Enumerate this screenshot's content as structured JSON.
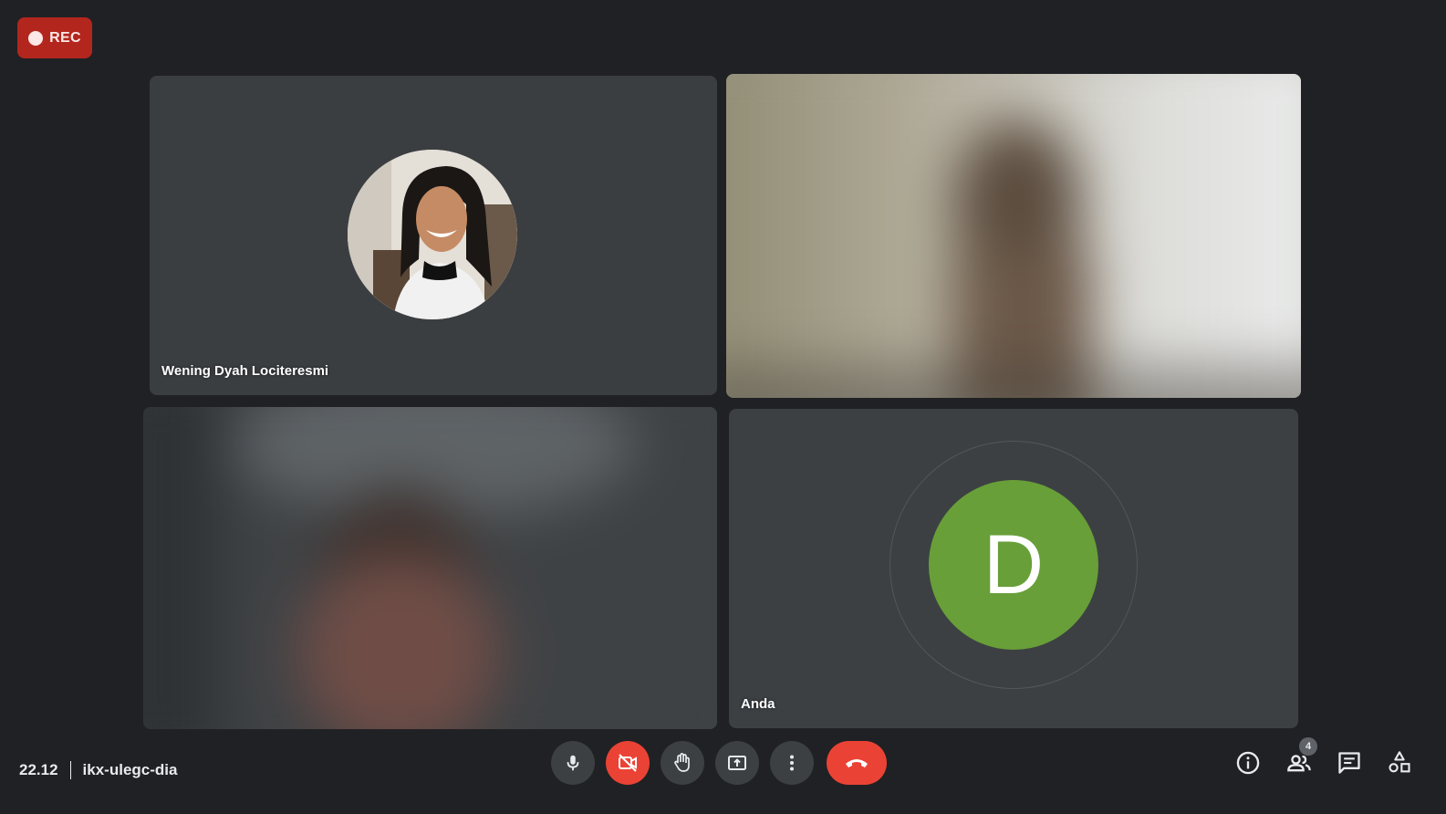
{
  "recording": {
    "label": "REC"
  },
  "participants": [
    {
      "name": "Wening Dyah Lociteresmi",
      "avatar_type": "photo"
    },
    {
      "name": "",
      "avatar_type": "video"
    },
    {
      "name": "",
      "avatar_type": "video"
    },
    {
      "name": "Anda",
      "avatar_type": "letter",
      "initial": "D",
      "avatar_color": "#689f38"
    }
  ],
  "footer": {
    "time": "22.12",
    "meeting_code": "ikx-ulegc-dia"
  },
  "controls": [
    {
      "name": "microphone",
      "icon": "mic-icon"
    },
    {
      "name": "camera-off",
      "icon": "camera-off-icon",
      "color": "#ea4335"
    },
    {
      "name": "raise-hand",
      "icon": "hand-icon"
    },
    {
      "name": "present",
      "icon": "present-icon"
    },
    {
      "name": "more-options",
      "icon": "more-vert-icon"
    },
    {
      "name": "leave-call",
      "icon": "end-call-icon",
      "color": "#ea4335"
    }
  ],
  "side_panel": {
    "people_count": "4",
    "icons": [
      "info-icon",
      "people-icon",
      "chat-icon",
      "activities-icon"
    ]
  },
  "colors": {
    "background": "#202124",
    "tile": "#3c4043",
    "danger": "#ea4335",
    "rec": "#b3261e"
  }
}
